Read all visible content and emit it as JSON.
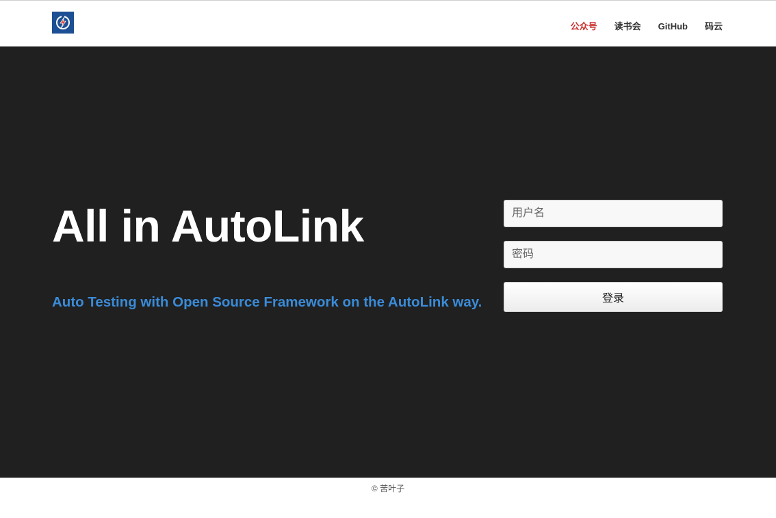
{
  "brand": {
    "logo_icon": "lightning-power-icon",
    "logo_color": "#1c4f93"
  },
  "nav": {
    "items": [
      {
        "label": "公众号",
        "active": true
      },
      {
        "label": "读书会",
        "active": false
      },
      {
        "label": "GitHub",
        "active": false
      },
      {
        "label": "码云",
        "active": false
      }
    ],
    "active_color": "#c9302c"
  },
  "hero": {
    "title": "All in AutoLink",
    "subtitle": "Auto Testing with Open Source Framework on the AutoLink way.",
    "background": "#202020",
    "subtitle_color": "#3a8bd8"
  },
  "login": {
    "username_placeholder": "用户名",
    "password_placeholder": "密码",
    "submit_label": "登录"
  },
  "footer": {
    "copyright": "© 苦叶子"
  }
}
